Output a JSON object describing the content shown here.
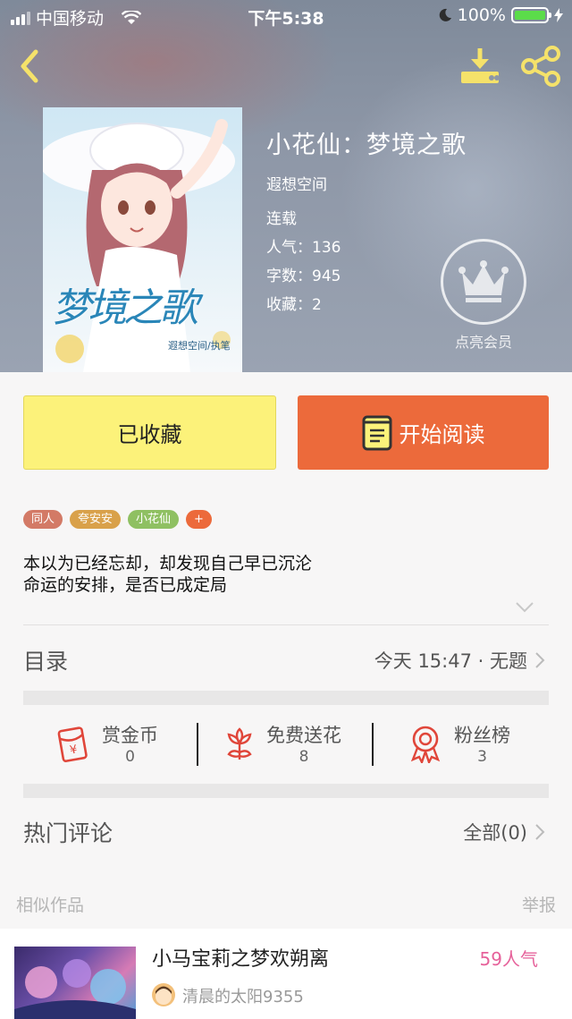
{
  "status_bar": {
    "carrier": "中国移动",
    "time": "下午5:38",
    "battery": "100%"
  },
  "book": {
    "title": "小花仙：梦境之歌",
    "author": "遐想空间",
    "status": "连载",
    "stats": [
      {
        "label": "人气：",
        "value": "136"
      },
      {
        "label": "字数：",
        "value": "945"
      },
      {
        "label": "收藏：",
        "value": "2"
      }
    ],
    "cover_title": "梦境之歌",
    "cover_credit": "遐想空间/执笔"
  },
  "vip_label": "点亮会员",
  "buttons": {
    "collect": "已收藏",
    "read": "开始阅读"
  },
  "tags": [
    {
      "label": "同人",
      "color": "#d37a66"
    },
    {
      "label": "夸安安",
      "color": "#d9a14a"
    },
    {
      "label": "小花仙",
      "color": "#8fc062"
    },
    {
      "label": "+",
      "color": "#ec6a3b"
    }
  ],
  "description": [
    "本以为已经忘却，却发现自己早已沉沦",
    "命运的安排，是否已成定局"
  ],
  "catalog": {
    "title": "目录",
    "latest": "今天 15:47 · 无题"
  },
  "actions": [
    {
      "label": "赏金币",
      "value": "0",
      "icon": "red-envelope-icon"
    },
    {
      "label": "免费送花",
      "value": "8",
      "icon": "flower-icon"
    },
    {
      "label": "粉丝榜",
      "value": "3",
      "icon": "medal-icon"
    }
  ],
  "comments": {
    "title": "热门评论",
    "all": "全部(0)"
  },
  "similar": {
    "title": "相似作品",
    "report": "举报",
    "item": {
      "name": "小马宝莉之梦欢朔离",
      "popularity": "59人气",
      "author": "清晨的太阳9355"
    }
  },
  "colors": {
    "accent_orange": "#ec6a3b",
    "collect_yellow": "#fcf27a",
    "icon_red": "#e0463a",
    "icon_yellow": "#f5e26a",
    "popularity_pink": "#e6619a"
  }
}
